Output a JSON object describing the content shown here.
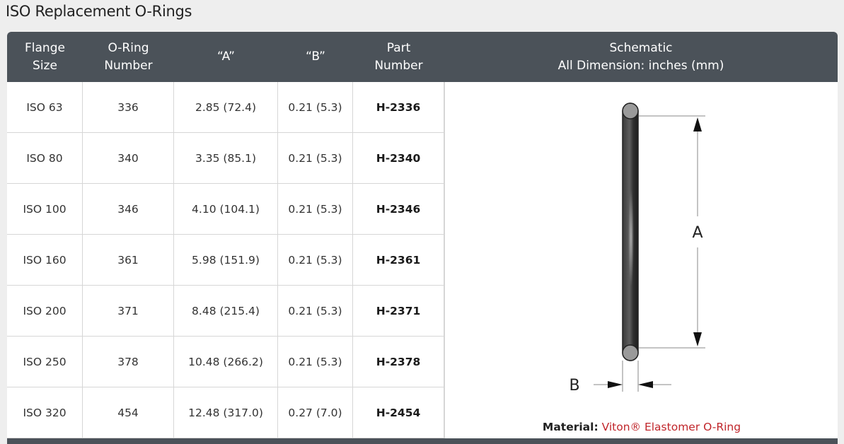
{
  "page": {
    "title": "ISO Replacement O-Rings"
  },
  "table": {
    "headers": {
      "flange_size": "Flange\nSize",
      "oring_number": "O-Ring\nNumber",
      "a": "“A”",
      "b": "“B”",
      "part_number": "Part\nNumber",
      "schematic": "Schematic\nAll Dimension: inches (mm)"
    },
    "rows": [
      {
        "flange": "ISO 63",
        "oring": "336",
        "a": "2.85 (72.4)",
        "b": "0.21 (5.3)",
        "part": "H-2336"
      },
      {
        "flange": "ISO 80",
        "oring": "340",
        "a": "3.35 (85.1)",
        "b": "0.21 (5.3)",
        "part": "H-2340"
      },
      {
        "flange": "ISO 100",
        "oring": "346",
        "a": "4.10 (104.1)",
        "b": "0.21 (5.3)",
        "part": "H-2346"
      },
      {
        "flange": "ISO 160",
        "oring": "361",
        "a": "5.98 (151.9)",
        "b": "0.21 (5.3)",
        "part": "H-2361"
      },
      {
        "flange": "ISO 200",
        "oring": "371",
        "a": "8.48 (215.4)",
        "b": "0.21 (5.3)",
        "part": "H-2371"
      },
      {
        "flange": "ISO 250",
        "oring": "378",
        "a": "10.48 (266.2)",
        "b": "0.21 (5.3)",
        "part": "H-2378"
      },
      {
        "flange": "ISO 320",
        "oring": "454",
        "a": "12.48 (317.0)",
        "b": "0.27 (7.0)",
        "part": "H-2454"
      }
    ]
  },
  "schematic": {
    "label_a": "A",
    "label_b": "B",
    "material_label": "Material:",
    "material_value": "Viton® Elastomer O-Ring"
  },
  "colors": {
    "header_bg": "#4b5259",
    "material_value": "#c0252a",
    "page_bg": "#eeeeee"
  }
}
